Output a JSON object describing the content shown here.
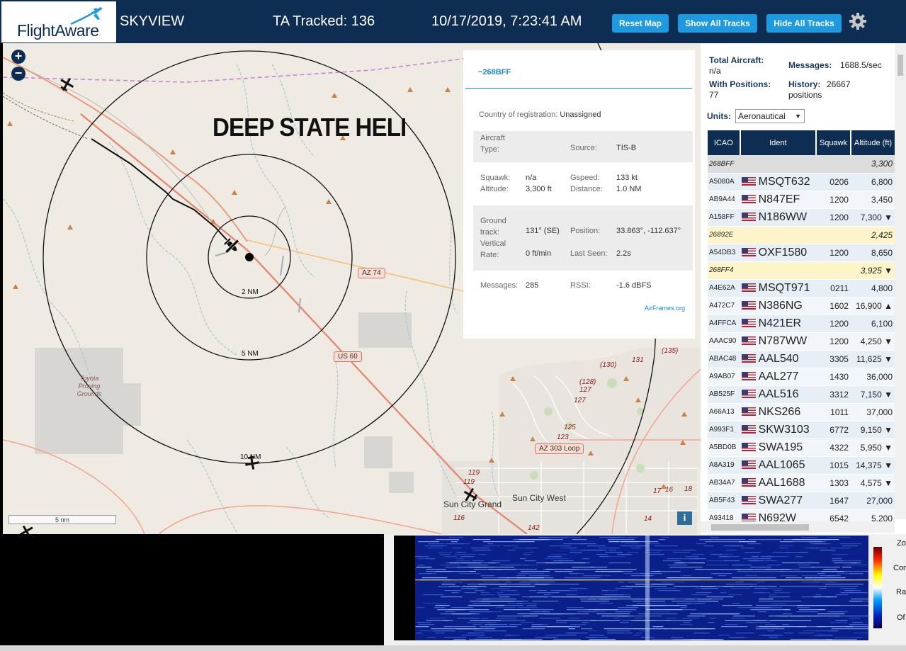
{
  "header": {
    "logo_text": "FlightAware",
    "app_title": "SKYVIEW",
    "ta_tracked": "TA Tracked: 136",
    "clock": "10/17/2019, 7:23:41 AM",
    "buttons": {
      "reset_map": "Reset Map",
      "show_all_tracks": "Show All Tracks",
      "hide_all_tracks": "Hide All Tracks"
    },
    "settings_icon": "gear-icon"
  },
  "map": {
    "zoom_in": "+",
    "zoom_out": "−",
    "annotation": "DEEP STATE HELI",
    "range_rings": [
      "2 NM",
      "5 NM",
      "10 NM"
    ],
    "roads": [
      "AZ 74",
      "US 60",
      "AZ 303 Loop"
    ],
    "places": [
      "Toyota Proving Grounds",
      "Sun City Grand",
      "Sun City West"
    ],
    "route_numbers": [
      "(135)",
      "131",
      "(130)",
      "(128)",
      "127",
      "127",
      "125",
      "123",
      "119",
      "119",
      "116",
      "142",
      "17",
      "16",
      "18",
      "14"
    ],
    "scale": "5 nm",
    "info_button": "i"
  },
  "aircraft_panel": {
    "hex": "~268BFF",
    "country_label": "Country of registration:",
    "country_value": "Unassigned",
    "aircraft_type_label": "Aircraft Type:",
    "aircraft_type_value": "",
    "source_label": "Source:",
    "source_value": "TIS-B",
    "squawk_label": "Squawk:",
    "squawk_value": "n/a",
    "altitude_label": "Altitude:",
    "altitude_value": "3,300 ft",
    "gspeed_label": "Gspeed:",
    "gspeed_value": "133 kt",
    "distance_label": "Distance:",
    "distance_value": "1.0 NM",
    "ground_track_label": "Ground track:",
    "ground_track_value": "131° (SE)",
    "position_label": "Position:",
    "position_value": "33.863°, -112.637°",
    "vertical_rate_label": "Vertical Rate:",
    "vertical_rate_value": "0 ft/min",
    "last_seen_label": "Last Seen:",
    "last_seen_value": "2.2s",
    "messages_label": "Messages:",
    "messages_value": "285",
    "rssi_label": "RSSI:",
    "rssi_value": "-1.6 dBFS",
    "airframes_link": "AirFrames.org"
  },
  "sidebar": {
    "total_aircraft_label": "Total Aircraft:",
    "total_aircraft_value": "n/a",
    "messages_label": "Messages:",
    "messages_value": "1688.5/sec",
    "with_positions_label": "With Positions:",
    "with_positions_value": "77",
    "history_label": "History:",
    "history_value": "26667 positions",
    "units_label": "Units:",
    "units_value": "Aeronautical",
    "columns": [
      "ICAO",
      "Ident",
      "Squawk",
      "Altitude (ft)"
    ],
    "rows": [
      {
        "icao": "268BFF",
        "ident": "",
        "squawk": "",
        "alt": "3,300",
        "flag": false,
        "style": "sel"
      },
      {
        "icao": "A5080A",
        "ident": "MSQT632",
        "squawk": "0206",
        "alt": "6,800",
        "flag": true,
        "style": ""
      },
      {
        "icao": "AB9A44",
        "ident": "N847EF",
        "squawk": "1200",
        "alt": "3,450",
        "flag": true,
        "style": "odd"
      },
      {
        "icao": "A158FF",
        "ident": "N186WW",
        "squawk": "1200",
        "alt": "7,300 ▼",
        "flag": true,
        "style": ""
      },
      {
        "icao": "26892E",
        "ident": "",
        "squawk": "",
        "alt": "2,425",
        "flag": false,
        "style": "tisb"
      },
      {
        "icao": "A54DB3",
        "ident": "OXF1580",
        "squawk": "1200",
        "alt": "8,650",
        "flag": true,
        "style": ""
      },
      {
        "icao": "268FF4",
        "ident": "",
        "squawk": "",
        "alt": "3,925 ▼",
        "flag": false,
        "style": "tisb"
      },
      {
        "icao": "A4E62A",
        "ident": "MSQT971",
        "squawk": "0211",
        "alt": "4,800",
        "flag": true,
        "style": ""
      },
      {
        "icao": "A472C7",
        "ident": "N386NG",
        "squawk": "1602",
        "alt": "16,900 ▲",
        "flag": true,
        "style": "odd"
      },
      {
        "icao": "A4FFCA",
        "ident": "N421ER",
        "squawk": "1200",
        "alt": "6,100",
        "flag": true,
        "style": ""
      },
      {
        "icao": "AAAC90",
        "ident": "N787WW",
        "squawk": "1200",
        "alt": "4,250 ▼",
        "flag": true,
        "style": "odd"
      },
      {
        "icao": "ABAC48",
        "ident": "AAL540",
        "squawk": "3305",
        "alt": "11,625 ▼",
        "flag": true,
        "style": ""
      },
      {
        "icao": "A9AB07",
        "ident": "AAL277",
        "squawk": "1430",
        "alt": "36,000",
        "flag": true,
        "style": "odd"
      },
      {
        "icao": "AB525F",
        "ident": "AAL516",
        "squawk": "3312",
        "alt": "7,150 ▼",
        "flag": true,
        "style": ""
      },
      {
        "icao": "A66A13",
        "ident": "NKS266",
        "squawk": "1011",
        "alt": "37,000",
        "flag": true,
        "style": "odd"
      },
      {
        "icao": "A993F1",
        "ident": "SKW3103",
        "squawk": "6772",
        "alt": "9,150 ▼",
        "flag": true,
        "style": ""
      },
      {
        "icao": "A5BD0B",
        "ident": "SWA195",
        "squawk": "4322",
        "alt": "5,950 ▼",
        "flag": true,
        "style": "odd"
      },
      {
        "icao": "A8A319",
        "ident": "AAL1065",
        "squawk": "1015",
        "alt": "14,375 ▼",
        "flag": true,
        "style": ""
      },
      {
        "icao": "AB34A7",
        "ident": "AAL1688",
        "squawk": "1303",
        "alt": "4,575 ▼",
        "flag": true,
        "style": "odd"
      },
      {
        "icao": "AB5F43",
        "ident": "SWA277",
        "squawk": "1647",
        "alt": "27,000",
        "flag": true,
        "style": ""
      },
      {
        "icao": "A93418",
        "ident": "N692W",
        "squawk": "6542",
        "alt": "5,200",
        "flag": true,
        "style": "odd"
      }
    ]
  },
  "sdr": {
    "labels": [
      "Zo",
      "Con",
      "Ra",
      "Of"
    ]
  },
  "colors": {
    "header_bg": "#0d2d52",
    "button_bg": "#1e9ae0",
    "link": "#1c8ccc",
    "tisb_row": "#fdf5c9",
    "selected_row": "#dcdcdc"
  }
}
